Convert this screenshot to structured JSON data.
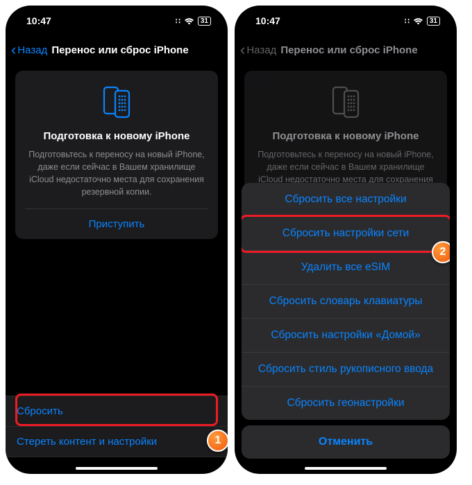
{
  "status": {
    "time": "10:47",
    "battery": "31"
  },
  "nav": {
    "back": "Назад",
    "title": "Перенос или сброс iPhone"
  },
  "card": {
    "title": "Подготовка к новому iPhone",
    "desc": "Подготовьтесь к переносу на новый iPhone, даже если сейчас в Вашем хранилище iCloud недостаточно места для сохранения резервной копии.",
    "action": "Приступить"
  },
  "left": {
    "rows": [
      {
        "label": "Сбросить"
      },
      {
        "label": "Стереть контент и настройки"
      }
    ]
  },
  "right": {
    "sheet": [
      "Сбросить все настройки",
      "Сбросить настройки сети",
      "Удалить все eSIM",
      "Сбросить словарь клавиатуры",
      "Сбросить настройки «Домой»",
      "Сбросить стиль рукописного ввода",
      "Сбросить геонастройки"
    ],
    "cancel": "Отменить"
  },
  "badges": {
    "one": "1",
    "two": "2"
  },
  "colors": {
    "accent": "#0a84ff",
    "highlight": "#ed1c24"
  }
}
